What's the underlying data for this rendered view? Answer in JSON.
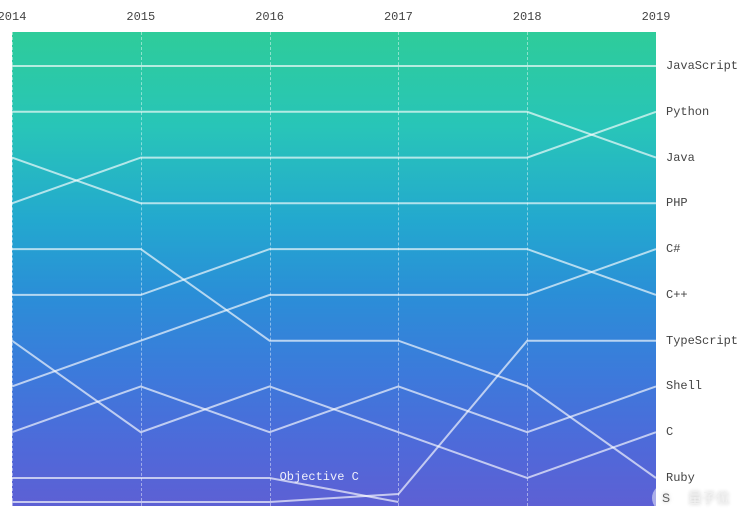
{
  "chart_data": {
    "type": "line",
    "xlabel": "",
    "ylabel": "",
    "title": "",
    "x_categories": [
      "2014",
      "2015",
      "2016",
      "2017",
      "2018",
      "2019"
    ],
    "y_is_rank": true,
    "y_rank_note": "1 = top; smaller rank = higher in chart",
    "inner_labels": [
      {
        "text": "Objective C",
        "x": "2016",
        "rank": 10
      }
    ],
    "series": [
      {
        "name": "JavaScript",
        "ranks": [
          1,
          1,
          1,
          1,
          1,
          1
        ]
      },
      {
        "name": "Python",
        "ranks": [
          4,
          3,
          3,
          3,
          3,
          2
        ]
      },
      {
        "name": "Java",
        "ranks": [
          2,
          2,
          2,
          2,
          2,
          3
        ]
      },
      {
        "name": "PHP",
        "ranks": [
          3,
          4,
          4,
          4,
          4,
          4
        ]
      },
      {
        "name": "C#",
        "ranks": [
          8,
          7,
          6,
          6,
          6,
          5
        ]
      },
      {
        "name": "C++",
        "ranks": [
          6,
          6,
          5,
          5,
          5,
          6
        ]
      },
      {
        "name": "TypeScript",
        "ranks": [
          12,
          12,
          12,
          11,
          7,
          7
        ]
      },
      {
        "name": "Shell",
        "ranks": [
          9,
          8,
          9,
          8,
          9,
          8
        ]
      },
      {
        "name": "C",
        "ranks": [
          7,
          9,
          8,
          9,
          10,
          9
        ]
      },
      {
        "name": "Ruby",
        "ranks": [
          5,
          5,
          7,
          7,
          8,
          10
        ]
      },
      {
        "name": "Objective C",
        "ranks": [
          10,
          10,
          10,
          12,
          null,
          null
        ]
      }
    ]
  },
  "watermark": {
    "icon_text": "S",
    "text": "量子位"
  }
}
